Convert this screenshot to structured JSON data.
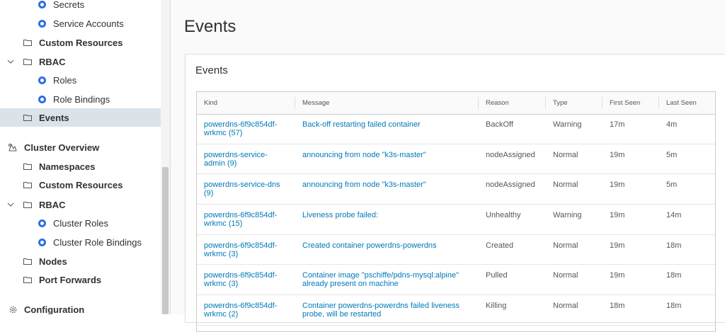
{
  "sidebar": {
    "items": [
      {
        "label": "Secrets",
        "icon": "kubernetes-icon"
      },
      {
        "label": "Service Accounts",
        "icon": "kubernetes-icon"
      },
      {
        "label": "Custom Resources",
        "icon": "folder-icon"
      },
      {
        "label": "RBAC",
        "icon": "folder-icon",
        "chevron": "chevron-down-icon"
      },
      {
        "label": "Roles",
        "icon": "kubernetes-icon"
      },
      {
        "label": "Role Bindings",
        "icon": "kubernetes-icon"
      },
      {
        "label": "Events",
        "icon": "folder-icon",
        "selected": true
      },
      {
        "label": "Cluster Overview",
        "icon": "cluster-icon"
      },
      {
        "label": "Namespaces",
        "icon": "folder-icon"
      },
      {
        "label": "Custom Resources",
        "icon": "folder-icon"
      },
      {
        "label": "RBAC",
        "icon": "folder-icon",
        "chevron": "chevron-down-icon"
      },
      {
        "label": "Cluster Roles",
        "icon": "kubernetes-icon"
      },
      {
        "label": "Cluster Role Bindings",
        "icon": "kubernetes-icon"
      },
      {
        "label": "Nodes",
        "icon": "folder-icon"
      },
      {
        "label": "Port Forwards",
        "icon": "folder-icon"
      },
      {
        "label": "Configuration",
        "icon": "gear-icon"
      }
    ]
  },
  "main": {
    "page_title": "Events",
    "card_title": "Events",
    "table": {
      "columns": [
        "Kind",
        "Message",
        "Reason",
        "Type",
        "First Seen",
        "Last Seen"
      ],
      "rows": [
        {
          "kind": "powerdns-6f9c854df-wrkmc (57)",
          "message": "Back-off restarting failed container",
          "reason": "BackOff",
          "type": "Warning",
          "first_seen": "17m",
          "last_seen": "4m"
        },
        {
          "kind": "powerdns-service-admin (9)",
          "message": "announcing from node \"k3s-master\"",
          "reason": "nodeAssigned",
          "type": "Normal",
          "first_seen": "19m",
          "last_seen": "5m"
        },
        {
          "kind": "powerdns-service-dns (9)",
          "message": "announcing from node \"k3s-master\"",
          "reason": "nodeAssigned",
          "type": "Normal",
          "first_seen": "19m",
          "last_seen": "5m"
        },
        {
          "kind": "powerdns-6f9c854df-wrkmc (15)",
          "message": "Liveness probe failed:",
          "reason": "Unhealthy",
          "type": "Warning",
          "first_seen": "19m",
          "last_seen": "14m"
        },
        {
          "kind": "powerdns-6f9c854df-wrkmc (3)",
          "message": "Created container powerdns-powerdns",
          "reason": "Created",
          "type": "Normal",
          "first_seen": "19m",
          "last_seen": "18m"
        },
        {
          "kind": "powerdns-6f9c854df-wrkmc (3)",
          "message": "Container image \"pschiffe/pdns-mysql:alpine\" already present on machine",
          "reason": "Pulled",
          "type": "Normal",
          "first_seen": "19m",
          "last_seen": "18m"
        },
        {
          "kind": "powerdns-6f9c854df-wrkmc (2)",
          "message": "Container powerdns-powerdns failed liveness probe, will be restarted",
          "reason": "Killing",
          "type": "Normal",
          "first_seen": "18m",
          "last_seen": "18m"
        }
      ]
    }
  },
  "colors": {
    "accent": "#0079b8",
    "selected_bg": "#dbe3ea",
    "kube_icon": "#2f6fe0"
  }
}
